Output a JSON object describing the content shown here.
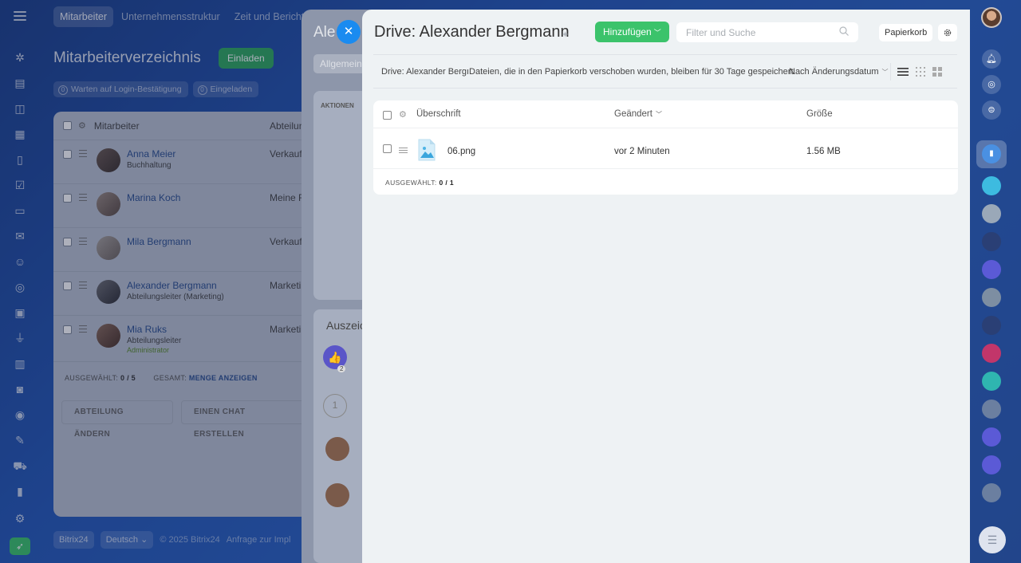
{
  "top_nav": {
    "tabs": [
      "Mitarbeiter",
      "Unternehmensstruktur",
      "Zeit und Berichte"
    ]
  },
  "background_page": {
    "title": "Mitarbeiterverzeichnis",
    "invite_button": "Einladen",
    "chips": [
      {
        "count": "0",
        "label": "Warten auf Login-Bestätigung"
      },
      {
        "count": "0",
        "label": "Eingeladen"
      }
    ],
    "table": {
      "col_employee": "Mitarbeiter",
      "col_department": "Abteilun",
      "rows": [
        {
          "name": "Anna Meier",
          "position": "Buchhaltung",
          "dept": "Verkauf",
          "admin": ""
        },
        {
          "name": "Marina Koch",
          "position": "",
          "dept": "Meine F",
          "admin": ""
        },
        {
          "name": "Mila Bergmann",
          "position": "",
          "dept": "Verkauf",
          "admin": ""
        },
        {
          "name": "Alexander Bergmann",
          "position": "Abteilungsleiter (Marketing)",
          "dept": "Marketin",
          "admin": ""
        },
        {
          "name": "Mia Ruks",
          "position": "Abteilungsleiter",
          "dept": "Marketin",
          "admin": "Administrator"
        }
      ],
      "selected_label": "AUSGEWÄHLT:",
      "selected_value": "0 / 5",
      "total_label": "GESAMT:",
      "total_link": "MENGE ANZEIGEN",
      "btn_change_dept": "ABTEILUNG ÄNDERN",
      "btn_create_chat": "EINEN CHAT ERSTELLEN"
    },
    "footer": {
      "brand": "Bitrix24",
      "language": "Deutsch",
      "copyright": "© 2025 Bitrix24",
      "request": "Anfrage zur Impl"
    }
  },
  "middle_panel": {
    "title": "Ale",
    "tab": "Allgemein",
    "actions": "AKTIONEN",
    "awards_title": "Auszeic",
    "badge_count": "2"
  },
  "drive": {
    "title": "Drive: Alexander Bergmann",
    "add_button": "Hinzufügen",
    "search_placeholder": "Filter und Suche",
    "trash_button": "Papierkorb",
    "info_text": "Drive: Alexander BergıDateien, die in den Papierkorb verschoben wurden, bleiben für 30 Tage gespeichert.",
    "sort_label": "Nach Änderungsdatum",
    "table": {
      "col_title": "Überschrift",
      "col_modified": "Geändert",
      "col_size": "Größe",
      "rows": [
        {
          "name": "06.png",
          "modified": "vor 2 Minuten",
          "size": "1.56 MB"
        }
      ],
      "selected_label": "AUSGEWÄHLT:",
      "selected_value": "0 / 1"
    }
  },
  "colors": {
    "accent_green": "#3bc36b",
    "accent_blue": "#1a8bf0",
    "link": "#2b4f8f"
  }
}
